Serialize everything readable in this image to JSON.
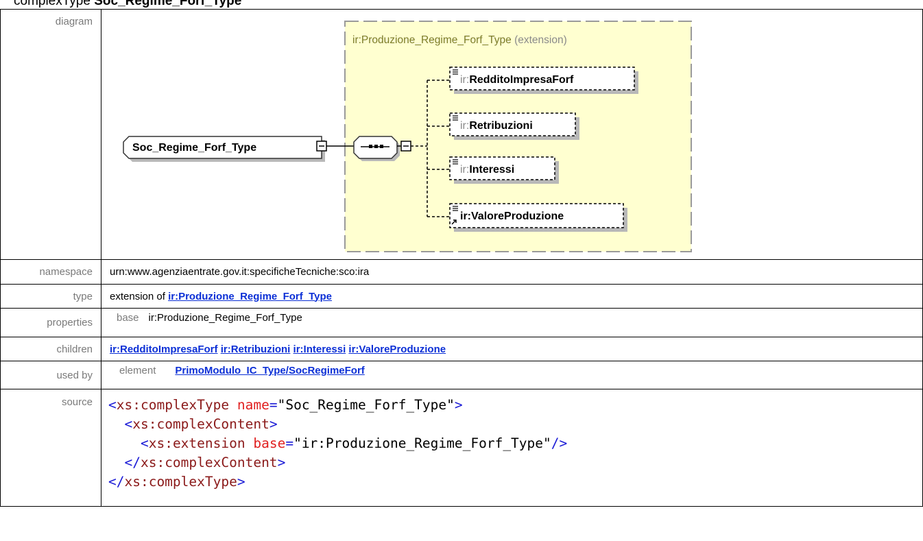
{
  "heading": {
    "prefix": "complexType ",
    "name": "Soc_Regime_Forf_Type"
  },
  "labels": {
    "diagram": "diagram",
    "namespace": "namespace",
    "type": "type",
    "properties": "properties",
    "children": "children",
    "used_by": "used by",
    "source": "source"
  },
  "diagram": {
    "group_title": "ir:Produzione_Regime_Forf_Type",
    "group_suffix": "(extension)",
    "root_name": "Soc_Regime_Forf_Type",
    "children": [
      {
        "prefix": "ir:",
        "name": "RedditoImpresaForf"
      },
      {
        "prefix": "ir:",
        "name": "Retribuzioni"
      },
      {
        "prefix": "ir:",
        "name": "Interessi"
      },
      {
        "prefix": "ir:",
        "name": "ValoreProduzione"
      }
    ]
  },
  "namespace": "urn:www.agenziaentrate.gov.it:specificheTecniche:sco:ira",
  "type": {
    "prefix": "extension of ",
    "link": "ir:Produzione_Regime_Forf_Type"
  },
  "properties": {
    "key": "base",
    "value": "ir:Produzione_Regime_Forf_Type"
  },
  "children_links": [
    "ir:RedditoImpresaForf",
    "ir:Retribuzioni",
    "ir:Interessi",
    "ir:ValoreProduzione"
  ],
  "used_by": {
    "key": "element",
    "link": "PrimoModulo_IC_Type/SocRegimeForf"
  },
  "source": {
    "line1_tag": "xs:complexType",
    "line1_attr": "name",
    "line1_val": "\"Soc_Regime_Forf_Type\"",
    "line2_tag": "xs:complexContent",
    "line3_tag": "xs:extension",
    "line3_attr": "base",
    "line3_val": "\"ir:Produzione_Regime_Forf_Type\"",
    "line4_tag": "xs:complexContent",
    "line5_tag": "xs:complexType"
  },
  "colors": {
    "group_fill": "#ffffd0",
    "group_border": "#9a9a9a",
    "link": "#0b2fd6"
  }
}
